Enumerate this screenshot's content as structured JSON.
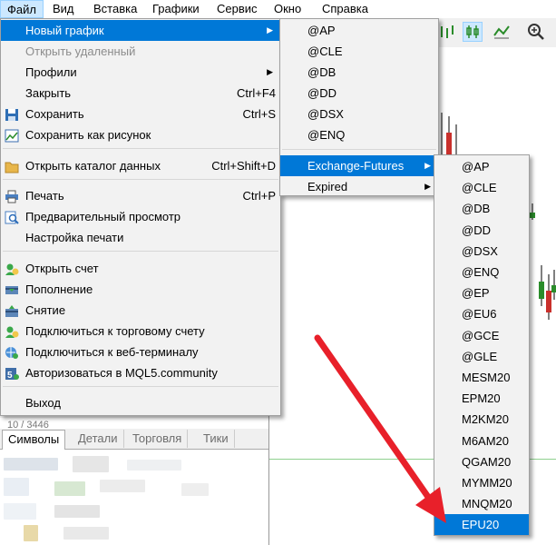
{
  "menubar": [
    "Файл",
    "Вид",
    "Вставка",
    "Графики",
    "Сервис",
    "Окно",
    "Справка"
  ],
  "file_menu": {
    "items": [
      {
        "label": "Новый график",
        "shortcut": "",
        "submenu": true
      },
      {
        "label": "Открыть удаленный",
        "shortcut": "",
        "submenu": false
      },
      {
        "label": "Профили",
        "shortcut": "",
        "submenu": true
      },
      {
        "label": "Закрыть",
        "shortcut": "Ctrl+F4",
        "submenu": false
      },
      {
        "label": "Сохранить",
        "shortcut": "Ctrl+S",
        "submenu": false
      },
      {
        "label": "Сохранить как рисунок",
        "shortcut": "",
        "submenu": false
      },
      {
        "label": "Открыть каталог данных",
        "shortcut": "Ctrl+Shift+D",
        "submenu": false
      },
      {
        "label": "Печать",
        "shortcut": "Ctrl+P",
        "submenu": false
      },
      {
        "label": "Предварительный просмотр",
        "shortcut": "",
        "submenu": false
      },
      {
        "label": "Настройка печати",
        "shortcut": "",
        "submenu": false
      },
      {
        "label": "Открыть счет",
        "shortcut": "",
        "submenu": false
      },
      {
        "label": "Пополнение",
        "shortcut": "",
        "submenu": false
      },
      {
        "label": "Снятие",
        "shortcut": "",
        "submenu": false
      },
      {
        "label": "Подключиться к торговому счету",
        "shortcut": "",
        "submenu": false
      },
      {
        "label": "Подключиться к веб-терминалу",
        "shortcut": "",
        "submenu": false
      },
      {
        "label": "Авторизоваться в MQL5.community",
        "shortcut": "",
        "submenu": false
      },
      {
        "label": "Выход",
        "shortcut": "",
        "submenu": false
      }
    ]
  },
  "new_chart_submenu": {
    "items": [
      "@AP",
      "@CLE",
      "@DB",
      "@DD",
      "@DSX",
      "@ENQ",
      "Exchange-Futures",
      "Expired"
    ]
  },
  "exchange_futures_submenu": {
    "items": [
      "@AP",
      "@CLE",
      "@DB",
      "@DD",
      "@DSX",
      "@ENQ",
      "@EP",
      "@EU6",
      "@GCE",
      "@GLE",
      "MESM20",
      "EPM20",
      "M2KM20",
      "M6AM20",
      "QGAM20",
      "MYMM20",
      "MNQM20",
      "EPU20"
    ]
  },
  "bottom_panel": {
    "tabs": [
      "Символы",
      "Детали",
      "Торговля",
      "Тики"
    ],
    "partial_text": "10 / 3446"
  },
  "colors": {
    "highlight": "#0078d7",
    "arrow": "#e8202a",
    "bull": "#2a8c2a",
    "bear": "#c9302c"
  }
}
